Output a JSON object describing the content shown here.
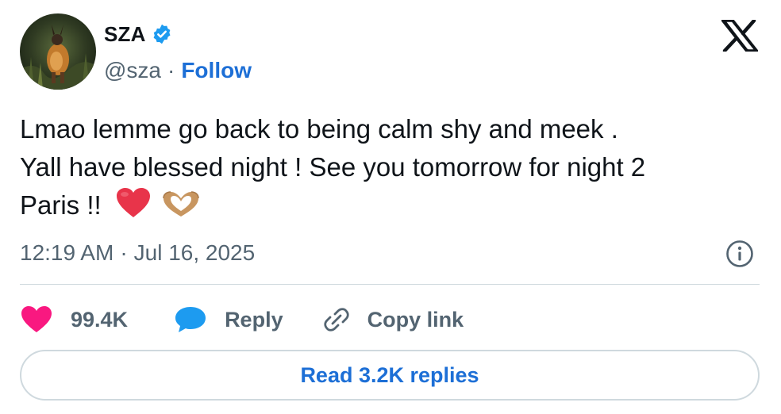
{
  "author": {
    "name": "SZA",
    "handle": "@sza",
    "separator": "·",
    "follow_label": "Follow",
    "verified": true,
    "verified_color": "#1d9bf0",
    "avatar_icon": "avatar-photo"
  },
  "platform_icon": "x-logo-icon",
  "tweet": {
    "text_line_1": "Lmao lemme go back to being calm shy and meek .",
    "text_line_2": "Yall have blessed night ! See you tomorrow for night 2",
    "text_line_3": "Paris !!",
    "emojis": [
      "red-heart-emoji",
      "heart-hands-emoji"
    ]
  },
  "meta": {
    "time": "12:19 AM",
    "separator": "·",
    "date": "Jul 16, 2025",
    "info_icon": "info-icon"
  },
  "actions": {
    "likes": "99.4K",
    "reply_label": "Reply",
    "copy_link_label": "Copy link",
    "like_color": "#f91880",
    "reply_color": "#1d9bf0"
  },
  "read_replies_label": "Read 3.2K replies",
  "colors": {
    "link_blue": "#1d6fd6",
    "secondary_text": "#536471",
    "border": "#cfd9de"
  }
}
